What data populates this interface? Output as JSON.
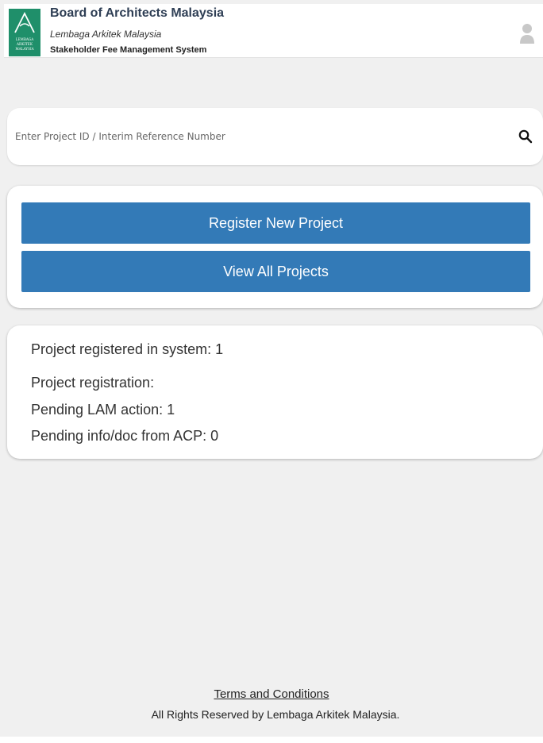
{
  "header": {
    "title": "Board of Architects Malaysia",
    "subtitle": "Lembaga Arkitek Malaysia",
    "system_name": "Stakeholder Fee Management System",
    "logo_text": [
      "LEMBAGA",
      "ARKITEK",
      "MALAYSIA"
    ],
    "logo_icon": "lam-logo-icon",
    "user_icon": "user-icon"
  },
  "search": {
    "placeholder": "Enter Project ID / Interim Reference Number",
    "icon": "search-icon"
  },
  "actions": {
    "register_label": "Register New Project",
    "view_all_label": "View All Projects"
  },
  "stats": {
    "registered": "Project registered in system: 1",
    "registration_heading": "Project registration:",
    "pending_lam": "Pending LAM action: 1",
    "pending_acp": "Pending info/doc from ACP: 0"
  },
  "footer": {
    "terms_label": "Terms and Conditions",
    "copyright": "All Rights Reserved by Lembaga Arkitek Malaysia."
  },
  "colors": {
    "primary_button": "#337ab7",
    "logo_green": "#1f8f6a",
    "page_background": "#f0f0f0",
    "title_text": "#2f3f55"
  }
}
